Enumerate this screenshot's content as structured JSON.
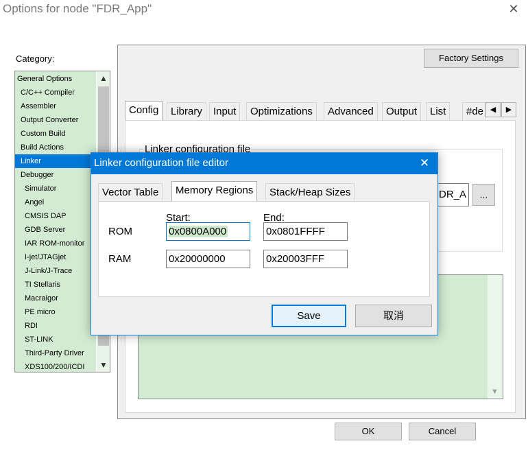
{
  "window": {
    "title": "Options for node \"FDR_App\"",
    "close_glyph": "✕"
  },
  "category": {
    "label": "Category:",
    "items": [
      {
        "label": "General Options",
        "level": 0
      },
      {
        "label": "C/C++ Compiler",
        "level": 1
      },
      {
        "label": "Assembler",
        "level": 1
      },
      {
        "label": "Output Converter",
        "level": 1
      },
      {
        "label": "Custom Build",
        "level": 1
      },
      {
        "label": "Build Actions",
        "level": 1
      },
      {
        "label": "Linker",
        "level": 1,
        "selected": true
      },
      {
        "label": "Debugger",
        "level": 1
      },
      {
        "label": "Simulator",
        "level": 2
      },
      {
        "label": "Angel",
        "level": 2
      },
      {
        "label": "CMSIS DAP",
        "level": 2
      },
      {
        "label": "GDB Server",
        "level": 2
      },
      {
        "label": "IAR ROM-monitor",
        "level": 2
      },
      {
        "label": "I-jet/JTAGjet",
        "level": 2
      },
      {
        "label": "J-Link/J-Trace",
        "level": 2
      },
      {
        "label": "TI Stellaris",
        "level": 2
      },
      {
        "label": "Macraigor",
        "level": 2
      },
      {
        "label": "PE micro",
        "level": 2
      },
      {
        "label": "RDI",
        "level": 2
      },
      {
        "label": "ST-LINK",
        "level": 2
      },
      {
        "label": "Third-Party Driver",
        "level": 2
      },
      {
        "label": "XDS100/200/ICDI",
        "level": 2
      }
    ]
  },
  "factory_settings_label": "Factory Settings",
  "tabs": [
    "Config",
    "Library",
    "Input",
    "Optimizations",
    "Advanced",
    "Output",
    "List",
    "#de"
  ],
  "config": {
    "group_title": "Linker configuration file",
    "path_value": "DR_A",
    "browse_label": "..."
  },
  "footer": {
    "ok_label": "OK",
    "cancel_label": "Cancel"
  },
  "dialog": {
    "title": "Linker configuration file editor",
    "close_glyph": "✕",
    "tabs": [
      "Vector Table",
      "Memory Regions",
      "Stack/Heap Sizes"
    ],
    "active_tab": "Memory Regions",
    "start_label": "Start:",
    "end_label": "End:",
    "regions": [
      {
        "name": "ROM",
        "start": "0x0800A000",
        "end": "0x0801FFFF"
      },
      {
        "name": "RAM",
        "start": "0x20000000",
        "end": "0x20003FFF"
      }
    ],
    "save_label": "Save",
    "cancel_label": "取消"
  },
  "colors": {
    "accent": "#0078d7",
    "list_bg": "#d2ebd2"
  }
}
